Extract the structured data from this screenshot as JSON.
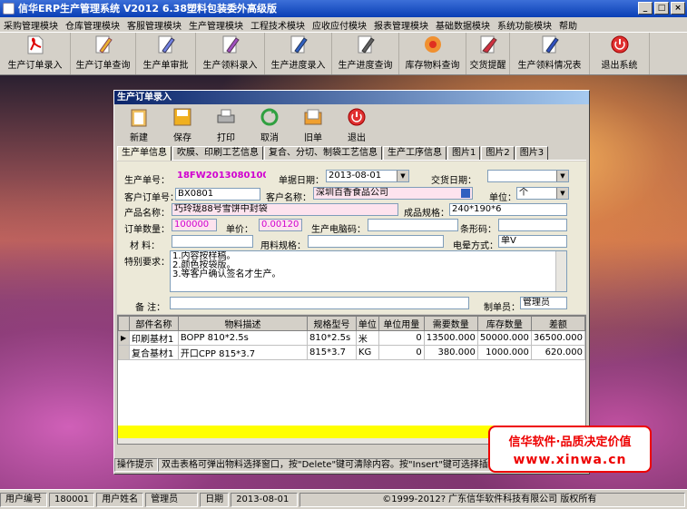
{
  "window_title": "信华ERP生产管理系统  V2012  6.38塑料包装委外高级版",
  "menu": [
    "采购管理模块",
    "仓库管理模块",
    "客服管理模块",
    "生产管理模块",
    "工程技术模块",
    "应收应付模块",
    "报表管理模块",
    "基础数据模块",
    "系统功能模块",
    "帮助"
  ],
  "toolbar": [
    "生产订单录入",
    "生产订单查询",
    "生产单审批",
    "生产领料录入",
    "生产进度录入",
    "生产进度查询",
    "库存物料查询",
    "交货提醒",
    "生产领料情况表",
    "退出系统"
  ],
  "child": {
    "title": "生产订单录入",
    "buttons": [
      "新建",
      "保存",
      "打印",
      "取消",
      "旧单",
      "退出"
    ],
    "tabs": [
      "生产单信息",
      "吹膜、印刷工艺信息",
      "复合、分切、制袋工艺信息",
      "生产工序信息",
      "图片1",
      "图片2",
      "图片3"
    ],
    "form": {
      "order_no_label": "生产单号：",
      "order_no": "18FW20130801002",
      "order_date_label": "单据日期：",
      "order_date": "2013-08-01",
      "delivery_label": "交货日期：",
      "delivery": "",
      "cust_order_label": "客户订单号：",
      "cust_order": "BX0801",
      "cust_name_label": "客户名称：",
      "cust_name": "深圳百香食品公司",
      "unit_label": "单位：",
      "unit": "个",
      "product_label": "产品名称：",
      "product": "巧玲珑88号雪饼中封袋",
      "spec_label": "成品规格：",
      "spec": "240*190*6",
      "qty_label": "订单数量：",
      "qty": "100000",
      "price_label": "单价：",
      "price": "0.00120",
      "code_label": "生产电脑码：",
      "code": "",
      "barcode_label": "条形码：",
      "barcode": "",
      "material_label": "材  料：",
      "material": "",
      "mat_spec_label": "用料规格：",
      "mat_spec": "",
      "corona_label": "电晕方式：",
      "corona": "单V",
      "special_label": "特别要求：",
      "special": [
        "1.内容按样稿。",
        "2.颜色按袋版。",
        "3.等客户确认签名才生产。"
      ],
      "remark_label": "备  注：",
      "remark": "",
      "maker_label": "制单员：",
      "maker": "管理员"
    },
    "grid": {
      "headers": [
        "部件名称",
        "物料描述",
        "规格型号",
        "单位",
        "单位用量",
        "需要数量",
        "库存数量",
        "差额"
      ],
      "rows": [
        [
          "印刷基材1",
          "BOPP 810*2.5s",
          "810*2.5s",
          "米",
          "0",
          "13500.000",
          "50000.000",
          "36500.000"
        ],
        [
          "复合基材1",
          "开口CPP 815*3.7",
          "815*3.7",
          "KG",
          "0",
          "380.000",
          "1000.000",
          "620.000"
        ]
      ]
    },
    "tip_label": "操作提示",
    "tip": "双击表格可弹出物料选择窗口，按\"Delete\"键可清除内容。按\"Insert\"键可选择插入"
  },
  "promo": {
    "line1": "信华软件·品质决定价值",
    "line2": "www.xinwa.cn"
  },
  "status": {
    "user_no_label": "用户编号",
    "user_no": "180001",
    "user_name_label": "用户姓名",
    "user_name": "管理员",
    "date_label": "日期",
    "date": "2013-08-01",
    "copyright": "©1999-2012?   广东信华软件科技有限公司    版权所有"
  }
}
